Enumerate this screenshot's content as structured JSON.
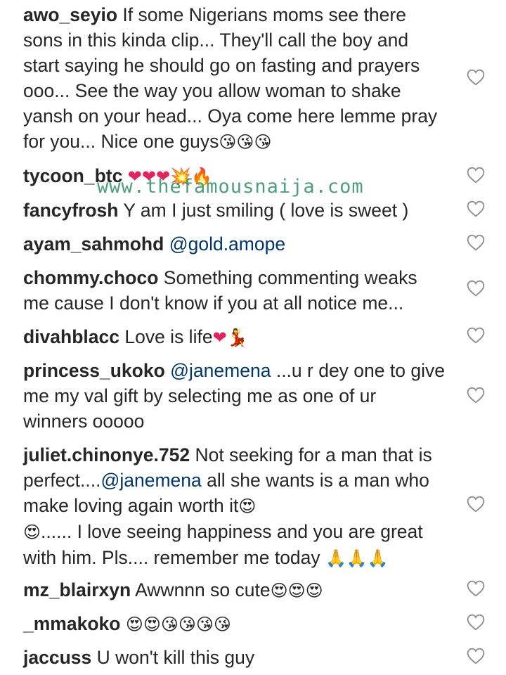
{
  "comments": [
    {
      "user": "awo_seyio",
      "text": "If some Nigerians moms see there sons in this kinda clip... They'll call the boy and start saying he should go on fasting and prayers ooo... See the way you allow woman to shake yansh on your head... Oya come here lemme pray for you... Nice one guys",
      "emoji": "😘😘😘"
    },
    {
      "user": "tycoon_btc",
      "text": "",
      "emoji": "❤❤❤💥🔥"
    },
    {
      "user": "fancyfrosh",
      "text": "Y am I just smiling ( love is sweet )",
      "emoji": ""
    },
    {
      "user": "ayam_sahmohd",
      "mention": "@gold.amope",
      "text": "",
      "emoji": ""
    },
    {
      "user": "chommy.choco",
      "text": "Something commenting weaks me cause I don't know if you at all notice me...",
      "emoji": ""
    },
    {
      "user": "divahblacc",
      "text": "Love is life",
      "emoji": "❤💃"
    },
    {
      "user": "princess_ukoko",
      "mention": "@janemena",
      "text": "...u r dey one to give me my val gift by selecting me as one of ur winners ooooo",
      "emoji": ""
    },
    {
      "user": "juliet.chinonye.752",
      "text": "Not seeking for a man that is perfect....",
      "mention": "@janemena",
      "text2": "all she wants is a man who make loving again worth it",
      "emoji": "😍",
      "text3": "...... I love seeing happiness and you are great with him. Pls.... remember me today",
      "emoji2": "🙏🙏🙏"
    },
    {
      "user": "mz_blairxyn",
      "text": "Awwnnn so cute",
      "emoji": "😍😍😍"
    },
    {
      "user": "_mmakoko",
      "text": "",
      "emoji": "😍😍😘😘😘😘"
    },
    {
      "user": "jaccuss",
      "text": "U won't kill this guy",
      "emoji": ""
    }
  ],
  "watermark": "www.thefamousnaija.com",
  "icons": {
    "like": "heart-outline-icon"
  }
}
